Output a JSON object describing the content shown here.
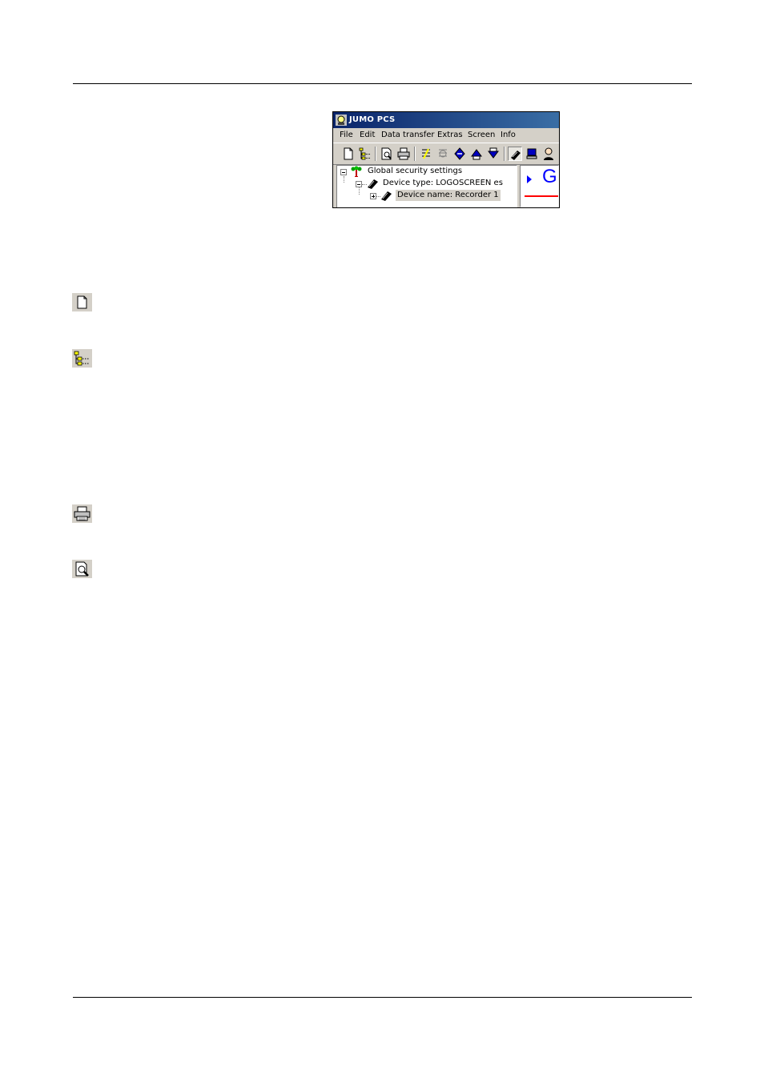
{
  "app": {
    "title": "JUMO PCS",
    "menu": [
      "File",
      "Edit",
      "Data transfer",
      "Extras",
      "Screen",
      "Info"
    ],
    "tree": [
      {
        "label": "Global security settings",
        "icon": "tree-icon"
      },
      {
        "label": "Device type: LOGOSCREEN es",
        "icon": "recorder-icon"
      },
      {
        "label": "Device name: Recorder 1",
        "icon": "recorder-icon",
        "selected": true
      }
    ],
    "preview_letter": "G"
  },
  "icons": [
    "new-document-icon",
    "tree-view-icon",
    "printer-icon",
    "print-preview-icon"
  ],
  "colors": {
    "titlebar": "#0a246a",
    "preview_text": "#0000ff",
    "preview_line": "#ff0000",
    "chrome": "#d4d0c8"
  }
}
